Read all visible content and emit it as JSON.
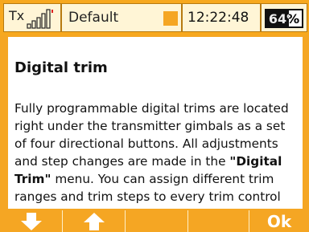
{
  "status": {
    "tx_label": "Tx",
    "profile_name": "Default",
    "time": "12:22:48",
    "battery_text": "64%",
    "battery_level": 0.64,
    "signal_bars": 5
  },
  "content": {
    "title": "Digital trim",
    "paragraph_part1": "Fully programmable digital trims are located right under the transmitter gimbals as a set of four directional buttons. All adjustments and step changes are made in the ",
    "paragraph_bold": "\"Digital Trim\"",
    "paragraph_part2": " menu. You can assign different trim ranges and trim steps to every trim control function."
  },
  "bottom": {
    "down_icon": "arrow-down-icon",
    "up_icon": "arrow-up-icon",
    "ok_label": "Ok"
  },
  "colors": {
    "accent": "#f5a623",
    "panel": "#fff5d6"
  }
}
